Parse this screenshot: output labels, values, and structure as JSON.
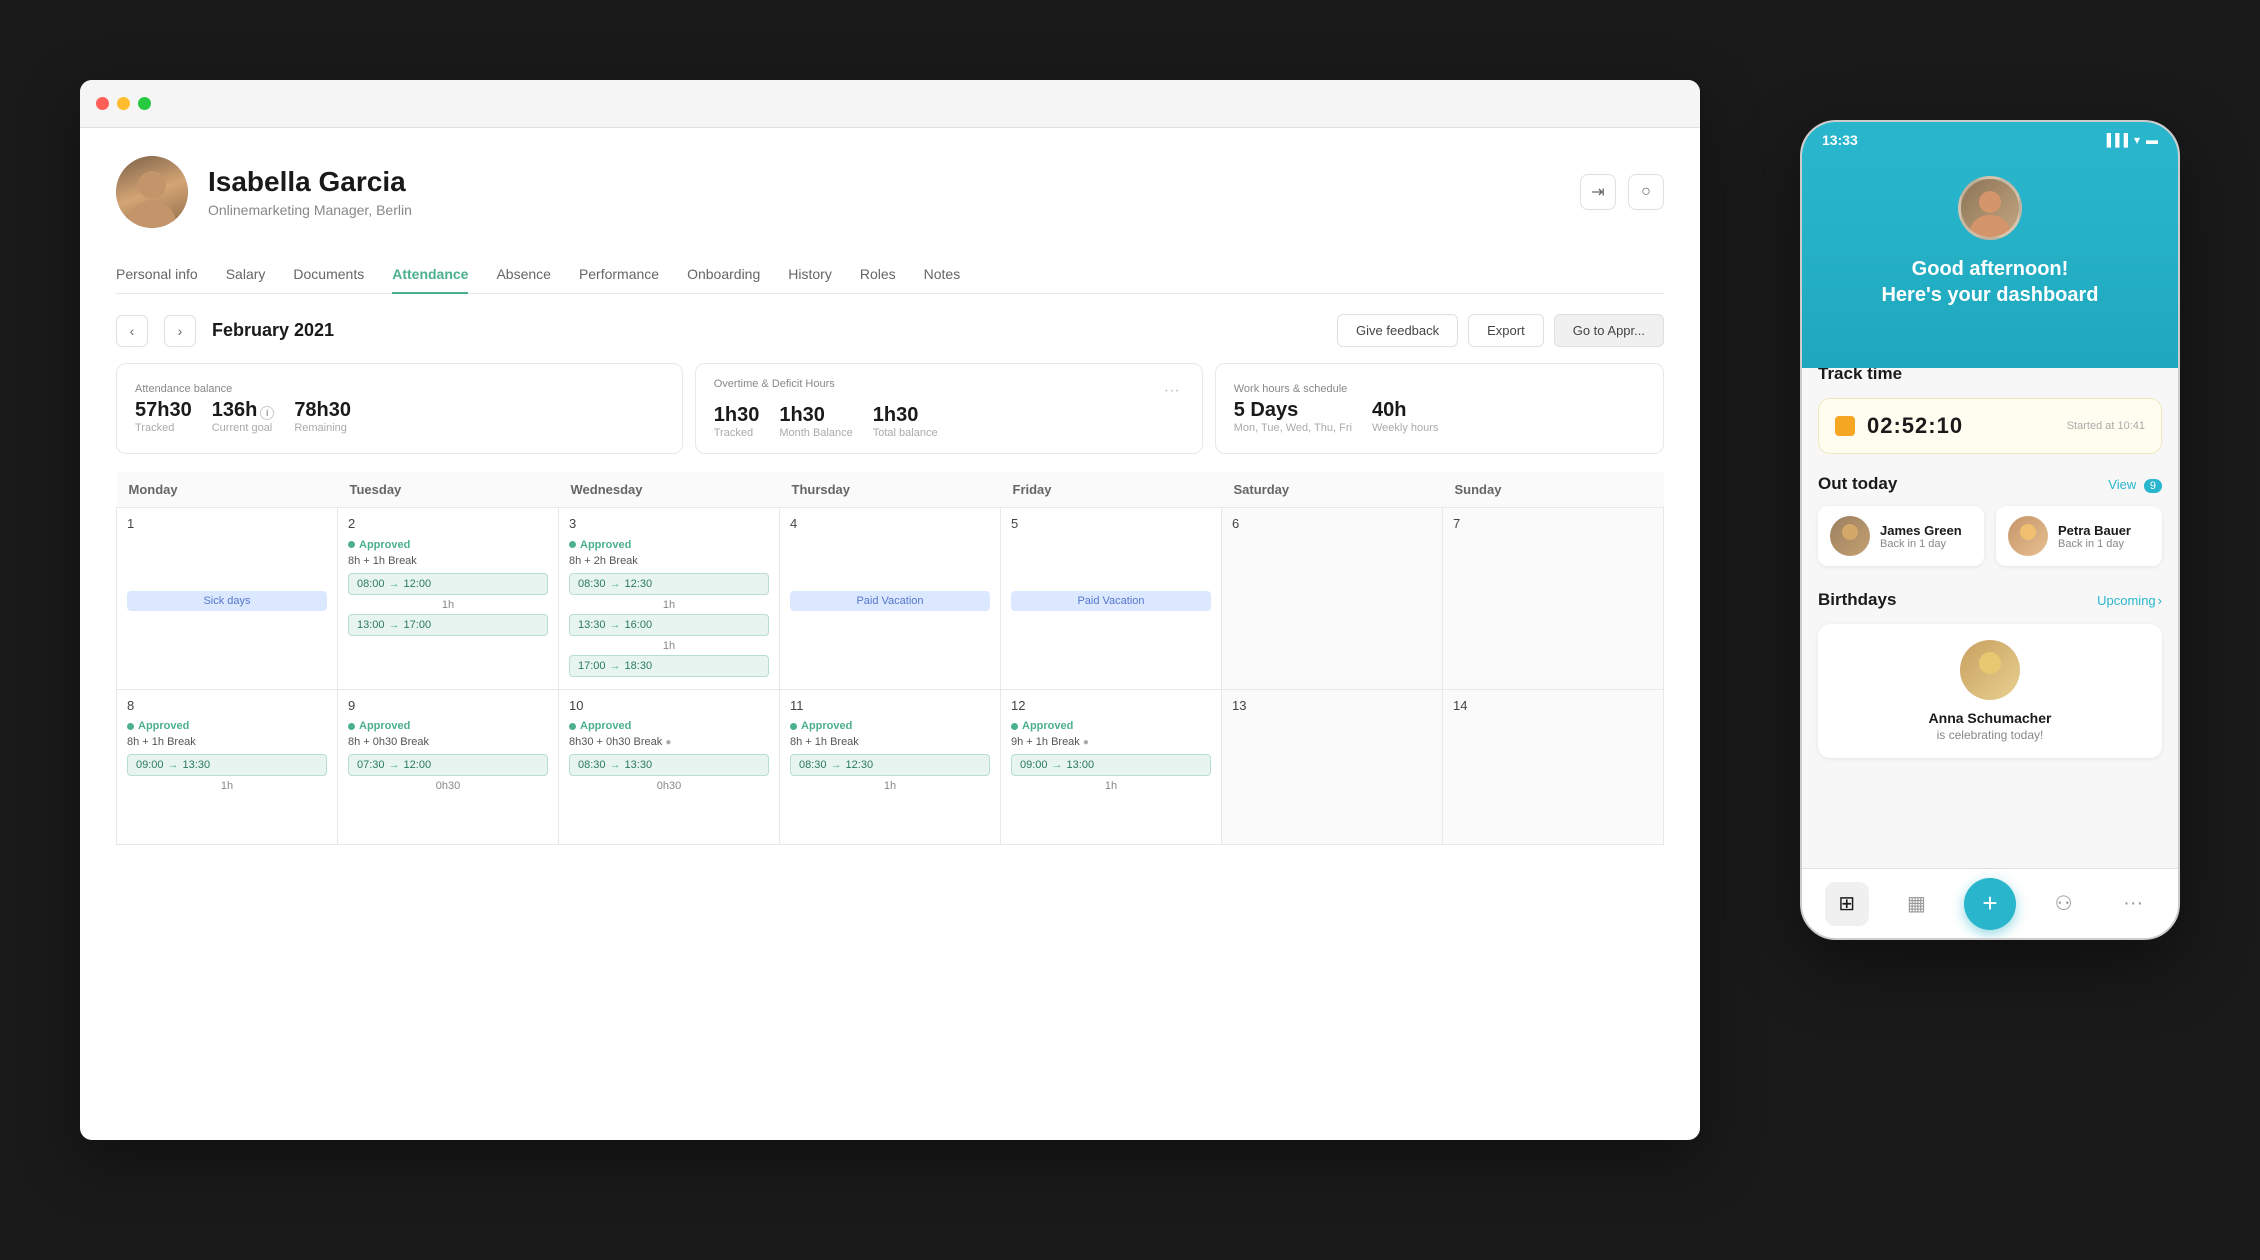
{
  "desktop": {
    "profile": {
      "name": "Isabella Garcia",
      "role": "Onlinemarketing Manager, Berlin"
    },
    "nav_tabs": [
      {
        "label": "Personal info",
        "active": false
      },
      {
        "label": "Salary",
        "active": false
      },
      {
        "label": "Documents",
        "active": false
      },
      {
        "label": "Attendance",
        "active": true
      },
      {
        "label": "Absence",
        "active": false
      },
      {
        "label": "Performance",
        "active": false
      },
      {
        "label": "Onboarding",
        "active": false
      },
      {
        "label": "History",
        "active": false
      },
      {
        "label": "Roles",
        "active": false
      },
      {
        "label": "Notes",
        "active": false
      }
    ],
    "calendar": {
      "month": "February 2021",
      "buttons": {
        "feedback": "Give feedback",
        "export": "Export",
        "go_to_approvals": "Go to Appr..."
      }
    },
    "stats": {
      "attendance_balance": "Attendance balance",
      "tracked_val": "57h30",
      "tracked_label": "Tracked",
      "goal_val": "136h",
      "goal_label": "Current goal",
      "remaining_val": "78h30",
      "remaining_label": "Remaining",
      "overtime_label": "Overtime & Deficit Hours",
      "ot_tracked_val": "1h30",
      "ot_tracked_label": "Tracked",
      "ot_month_val": "1h30",
      "ot_month_label": "Month Balance",
      "ot_total_val": "1h30",
      "ot_total_label": "Total balance",
      "work_hours_label": "Work hours & schedule",
      "days_val": "5 Days",
      "days_sub": "Mon, Tue, Wed, Thu, Fri",
      "weekly_val": "40h",
      "weekly_label": "Weekly hours"
    },
    "calendar_days": {
      "headers": [
        "Monday",
        "Tuesday",
        "Wednesday",
        "Thursday",
        "Friday",
        "Saturday",
        "Sunday"
      ]
    }
  },
  "mobile": {
    "status_time": "13:33",
    "greeting": "Good afternoon!\nHere's your dashboard",
    "sections": {
      "track_time": {
        "title": "Track time",
        "timer": "02:52:10",
        "started_at": "Started at 10:41"
      },
      "out_today": {
        "title": "Out today",
        "view_label": "View",
        "count": "9",
        "people": [
          {
            "name": "James Green",
            "status": "Back in 1 day"
          },
          {
            "name": "Petra Bauer",
            "status": "Back in 1 day"
          }
        ]
      },
      "birthdays": {
        "title": "Birthdays",
        "link": "Upcoming",
        "person": {
          "name": "Anna Schumacher",
          "sub": "is celebrating today!"
        }
      }
    },
    "nav": {
      "items": [
        "grid-icon",
        "calendar-icon",
        "plus-icon",
        "people-icon",
        "more-icon"
      ]
    }
  }
}
